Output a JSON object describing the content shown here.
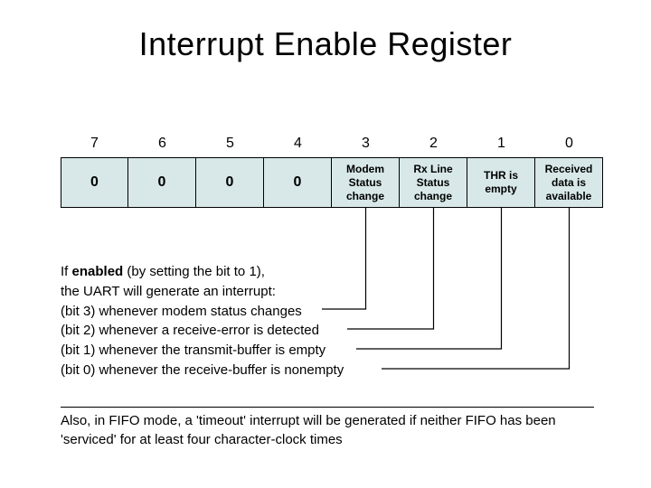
{
  "title": "Interrupt Enable Register",
  "bits": {
    "numbers": [
      "7",
      "6",
      "5",
      "4",
      "3",
      "2",
      "1",
      "0"
    ],
    "cells": [
      {
        "text": "0",
        "big": true
      },
      {
        "text": "0",
        "big": true
      },
      {
        "text": "0",
        "big": true
      },
      {
        "text": "0",
        "big": true
      },
      {
        "text": "Modem Status change",
        "big": false
      },
      {
        "text": "Rx Line Status change",
        "big": false
      },
      {
        "text": "THR is empty",
        "big": false
      },
      {
        "text": "Received data is available",
        "big": false
      }
    ]
  },
  "explain": {
    "intro_bold": "enabled",
    "intro_before": "If ",
    "intro_after": " (by setting the bit to 1),",
    "l2": "the UART will generate an interrupt:",
    "l3": "(bit 3) whenever modem status changes",
    "l4": "(bit 2) whenever a receive-error is detected",
    "l5": "(bit 1) whenever the transmit-buffer is empty",
    "l6": "(bit 0) whenever the receive-buffer is nonempty"
  },
  "footnote": "Also, in FIFO mode, a 'timeout' interrupt will be generated if neither FIFO has been 'serviced' for at least four character-clock times"
}
